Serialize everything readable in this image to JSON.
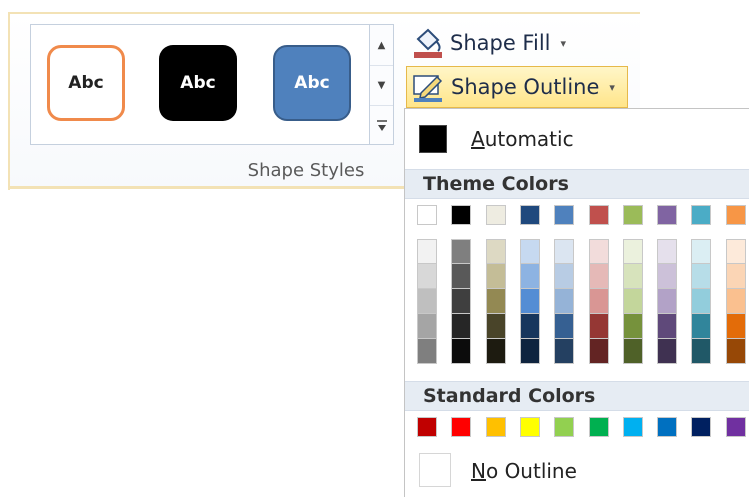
{
  "gallery": {
    "thumbs": [
      {
        "label": "Abc",
        "style": "orange-outline"
      },
      {
        "label": "Abc",
        "style": "black-fill"
      },
      {
        "label": "Abc",
        "style": "blue-fill"
      }
    ],
    "scroll_icons": [
      "chevron-up-icon",
      "chevron-down-icon",
      "more-icon"
    ]
  },
  "group_label": "Shape Styles",
  "commands": {
    "shape_fill": {
      "label": "Shape Fill",
      "icon": "paint-bucket-icon",
      "caret": "▾"
    },
    "shape_outline": {
      "label": "Shape Outline",
      "icon": "pencil-outline-icon",
      "caret": "▾"
    }
  },
  "dropdown": {
    "automatic_prefix": "A",
    "automatic_rest": "utomatic",
    "theme_colors_title": "Theme Colors",
    "standard_colors_title": "Standard Colors",
    "no_outline_prefix": "N",
    "no_outline_rest": "o Outline",
    "theme_top_row": [
      "#ffffff",
      "#000000",
      "#eeece1",
      "#1f497d",
      "#4f81bd",
      "#c0504d",
      "#9bbb59",
      "#8064a2",
      "#4bacc6",
      "#f79646"
    ],
    "theme_shades": [
      [
        "#f2f2f2",
        "#d8d8d8",
        "#bfbfbf",
        "#a5a5a5",
        "#7f7f7f"
      ],
      [
        "#7f7f7f",
        "#595959",
        "#3f3f3f",
        "#262626",
        "#0c0c0c"
      ],
      [
        "#ddd9c3",
        "#c4bd97",
        "#938953",
        "#494429",
        "#1d1b10"
      ],
      [
        "#c6d9f0",
        "#8db3e2",
        "#548dd4",
        "#17365d",
        "#0f243e"
      ],
      [
        "#dbe5f1",
        "#b8cce4",
        "#95b3d7",
        "#366092",
        "#244061"
      ],
      [
        "#f2dcdb",
        "#e5b9b7",
        "#d99694",
        "#953734",
        "#632423"
      ],
      [
        "#ebf1dd",
        "#d7e3bc",
        "#c3d69b",
        "#76923c",
        "#4f6128"
      ],
      [
        "#e5e0ec",
        "#ccc1d9",
        "#b2a2c7",
        "#5f497a",
        "#3f3151"
      ],
      [
        "#dbeef3",
        "#b7dde8",
        "#92cddc",
        "#31859b",
        "#205867"
      ],
      [
        "#fdeada",
        "#fbd5b5",
        "#fac08f",
        "#e36c09",
        "#974806"
      ]
    ],
    "standard_colors": [
      "#c00000",
      "#ff0000",
      "#ffc000",
      "#ffff00",
      "#92d050",
      "#00b050",
      "#00b0f0",
      "#0070c0",
      "#002060",
      "#7030a0"
    ]
  }
}
